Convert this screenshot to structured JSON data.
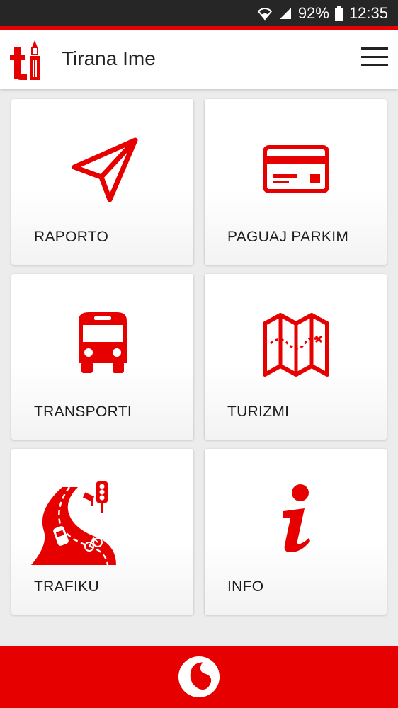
{
  "status_bar": {
    "battery": "92%",
    "time": "12:35"
  },
  "app": {
    "title": "Tirana Ime"
  },
  "tiles": [
    {
      "label": "RAPORTO",
      "icon": "paper-plane-icon"
    },
    {
      "label": "PAGUAJ PARKIM",
      "icon": "credit-card-icon"
    },
    {
      "label": "TRANSPORTI",
      "icon": "bus-icon"
    },
    {
      "label": "TURIZMI",
      "icon": "map-icon"
    },
    {
      "label": "TRAFIKU",
      "icon": "traffic-road-icon"
    },
    {
      "label": "INFO",
      "icon": "info-icon"
    }
  ],
  "colors": {
    "brand": "#e60000",
    "status_bar": "#262626",
    "background": "#ececec"
  }
}
